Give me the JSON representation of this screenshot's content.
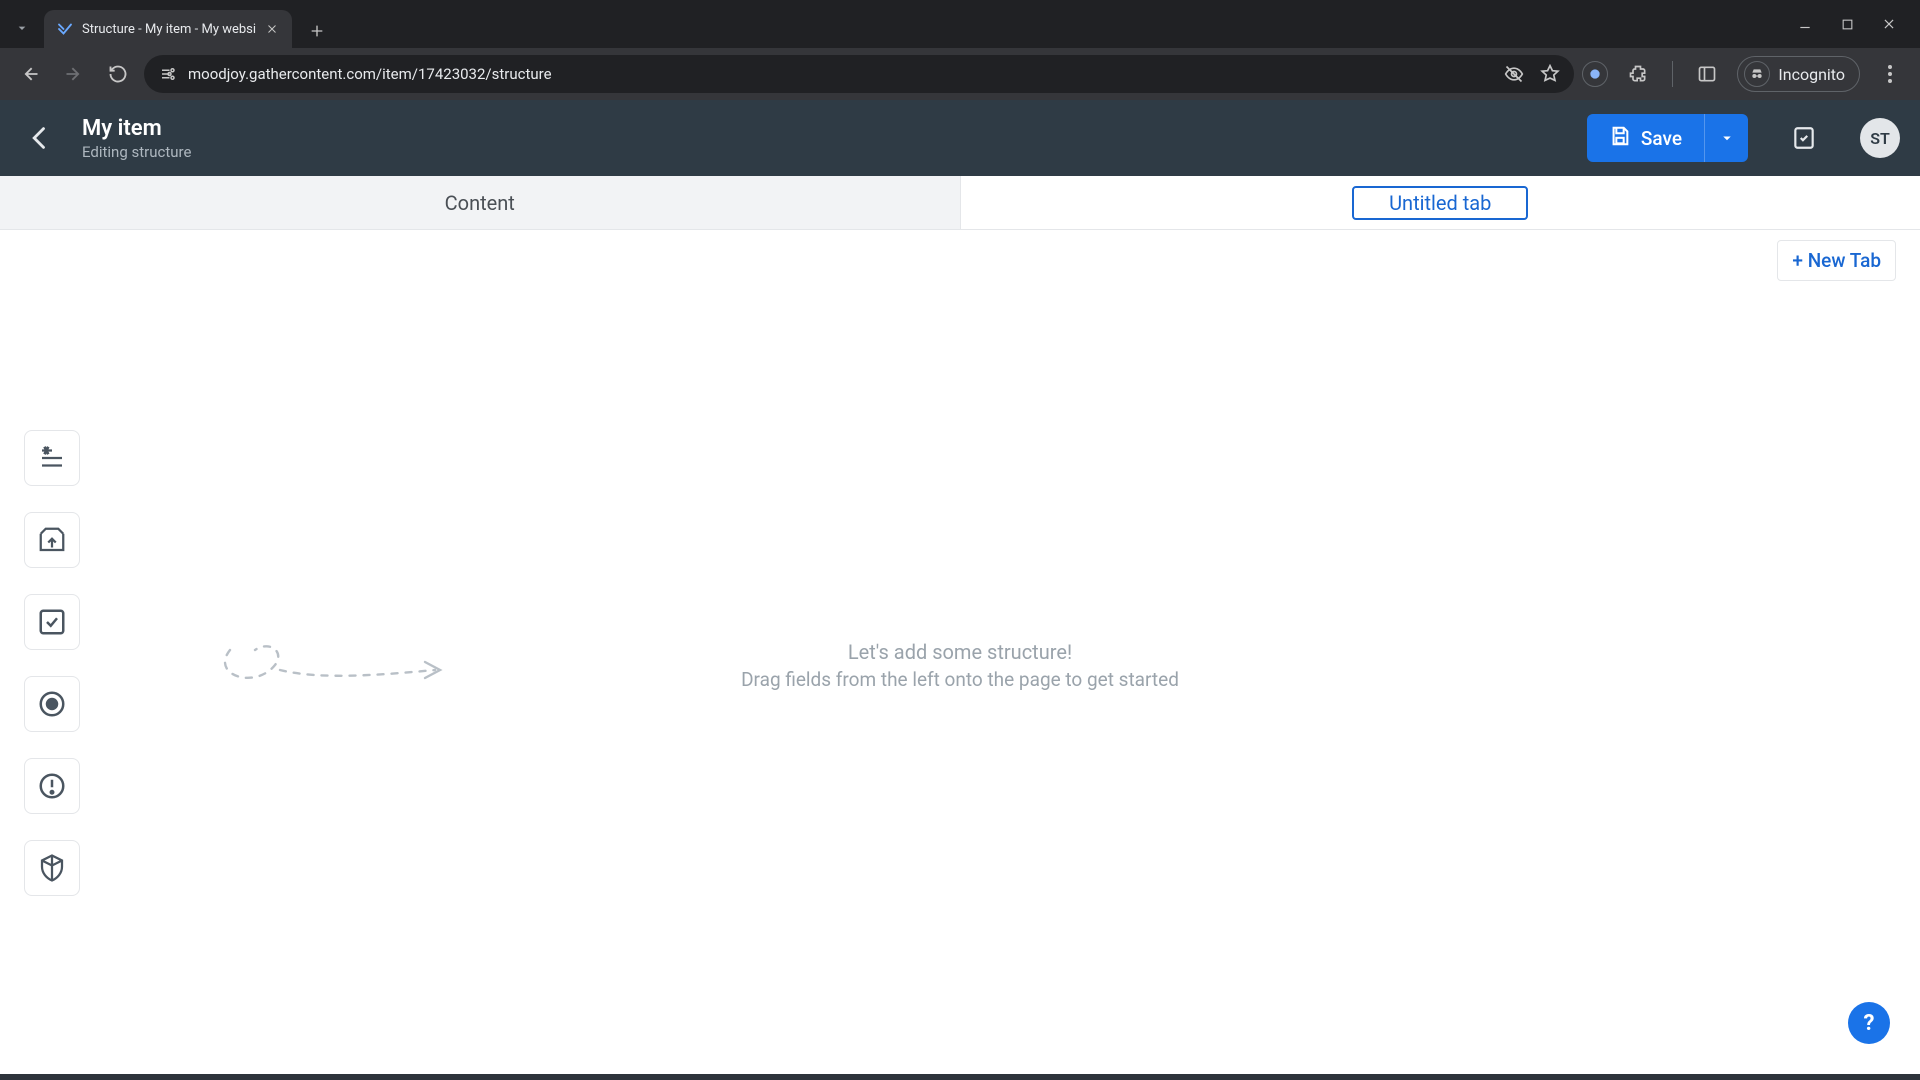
{
  "browser": {
    "tab_title": "Structure - My item - My websi",
    "url": "moodjoy.gathercontent.com/item/17423032/structure",
    "incognito_label": "Incognito"
  },
  "header": {
    "title": "My item",
    "subtitle": "Editing structure",
    "save_label": "Save",
    "avatar_initials": "ST"
  },
  "tabs": {
    "items": [
      {
        "label": "Content",
        "active": false
      },
      {
        "label": "Untitled tab",
        "active": true,
        "editing": true
      }
    ],
    "new_tab_label": "+ New Tab"
  },
  "toolRail": {
    "items": [
      {
        "name": "text-field-icon"
      },
      {
        "name": "attachment-field-icon"
      },
      {
        "name": "checkbox-field-icon"
      },
      {
        "name": "radio-field-icon"
      },
      {
        "name": "guideline-field-icon"
      },
      {
        "name": "component-field-icon"
      }
    ]
  },
  "empty": {
    "line1": "Let's add some structure!",
    "line2": "Drag fields from the left onto the page to get started"
  },
  "help": {
    "label": "?"
  }
}
